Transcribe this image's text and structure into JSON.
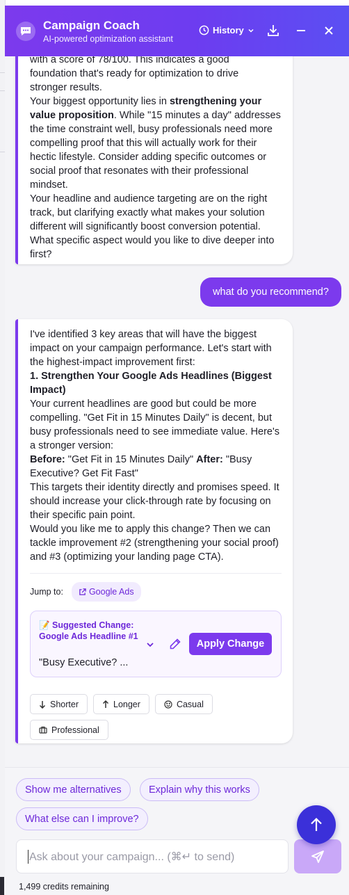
{
  "header": {
    "title": "Campaign Coach",
    "subtitle": "AI-powered optimization assistant",
    "history_label": "History"
  },
  "messages": {
    "first": {
      "lines": [
        "with a score of 78/100. This indicates a good",
        "foundation that's ready for optimization to drive",
        "stronger results."
      ],
      "p2_pre": "Your biggest opportunity lies in ",
      "p2_bold": "strengthening your value proposition",
      "p2_post": ". While \"15 minutes a day\" addresses the time constraint well, busy professionals need more compelling proof that this will actually work for their hectic lifestyle. Consider adding specific outcomes or social proof that resonates with their professional mindset.",
      "p3": "Your headline and audience targeting are on the right track, but clarifying exactly what makes your solution different will significantly boost conversion potential. What specific aspect would you like to dive deeper into first?"
    },
    "user": "what do you recommend?",
    "second": {
      "intro": "I've identified 3 key areas that will have the biggest impact on your campaign performance. Let's start with the highest-impact improvement first:",
      "heading": "1. Strengthen Your Google Ads Headlines (Biggest Impact)",
      "body1": "Your current headlines are good but could be more compelling. \"Get Fit in 15 Minutes Daily\" is decent, but busy professionals need to see immediate value. Here's a stronger version:",
      "before_label": "Before:",
      "before_text": " \"Get Fit in 15 Minutes Daily\" ",
      "after_label": "After:",
      "after_text": " \"Busy Executive? Get Fit Fast\"",
      "body2": "This targets their identity directly and promises speed. It should increase your click-through rate by focusing on their specific pain point.",
      "body3": "Would you like me to apply this change? Then we can tackle improvement #2 (strengthening your social proof) and #3 (optimizing your landing page CTA).",
      "jump_label": "Jump to:",
      "jump_link": "Google Ads",
      "suggestion": {
        "title": "📝 Suggested Change: Google Ads Headline #1",
        "preview": "\"Busy Executive? ...",
        "apply_label": "Apply Change"
      },
      "tones": [
        "Shorter",
        "Longer",
        "Casual",
        "Professional"
      ]
    }
  },
  "quick_replies": [
    "Show me alternatives",
    "Explain why this works",
    "What else can I improve?"
  ],
  "input": {
    "placeholder": "Ask about your campaign... (⌘↵ to send)"
  },
  "credits": "1,499 credits remaining",
  "colors": {
    "accent": "#7c3aed",
    "scroll_button": "#3b30d9",
    "send_disabled": "#c9a8f8"
  }
}
